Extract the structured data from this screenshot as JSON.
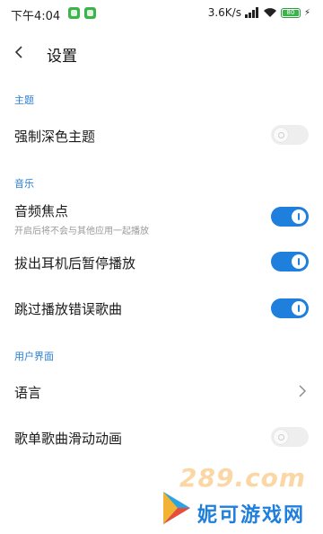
{
  "status_bar": {
    "time": "下午4:04",
    "speed": "3.6K/s",
    "hd_label": "HD",
    "battery": "80",
    "colors": {
      "notif": "#3bb54a",
      "battery": "#39b54a"
    }
  },
  "header": {
    "title": "设置",
    "back_icon": "chevron-left-icon"
  },
  "sections": [
    {
      "header": "主题",
      "items": [
        {
          "title": "强制深色主题",
          "control": "toggle",
          "enabled": false
        }
      ]
    },
    {
      "header": "音乐",
      "items": [
        {
          "title": "音频焦点",
          "subtitle": "开启后将不会与其他应用一起播放",
          "control": "toggle",
          "enabled": true
        },
        {
          "title": "拔出耳机后暂停播放",
          "control": "toggle",
          "enabled": true
        },
        {
          "title": "跳过播放错误歌曲",
          "control": "toggle",
          "enabled": true
        }
      ]
    },
    {
      "header": "用户界面",
      "items": [
        {
          "title": "语言",
          "control": "chevron"
        },
        {
          "title": "歌单歌曲滑动动画",
          "control": "toggle",
          "enabled": false
        }
      ]
    }
  ],
  "watermark": {
    "logo": "289.com",
    "text": "妮可游戏网"
  },
  "colors": {
    "accent": "#1f7fdc",
    "section_header": "#2a7fd6",
    "toggle_off": "#eeeeee"
  }
}
